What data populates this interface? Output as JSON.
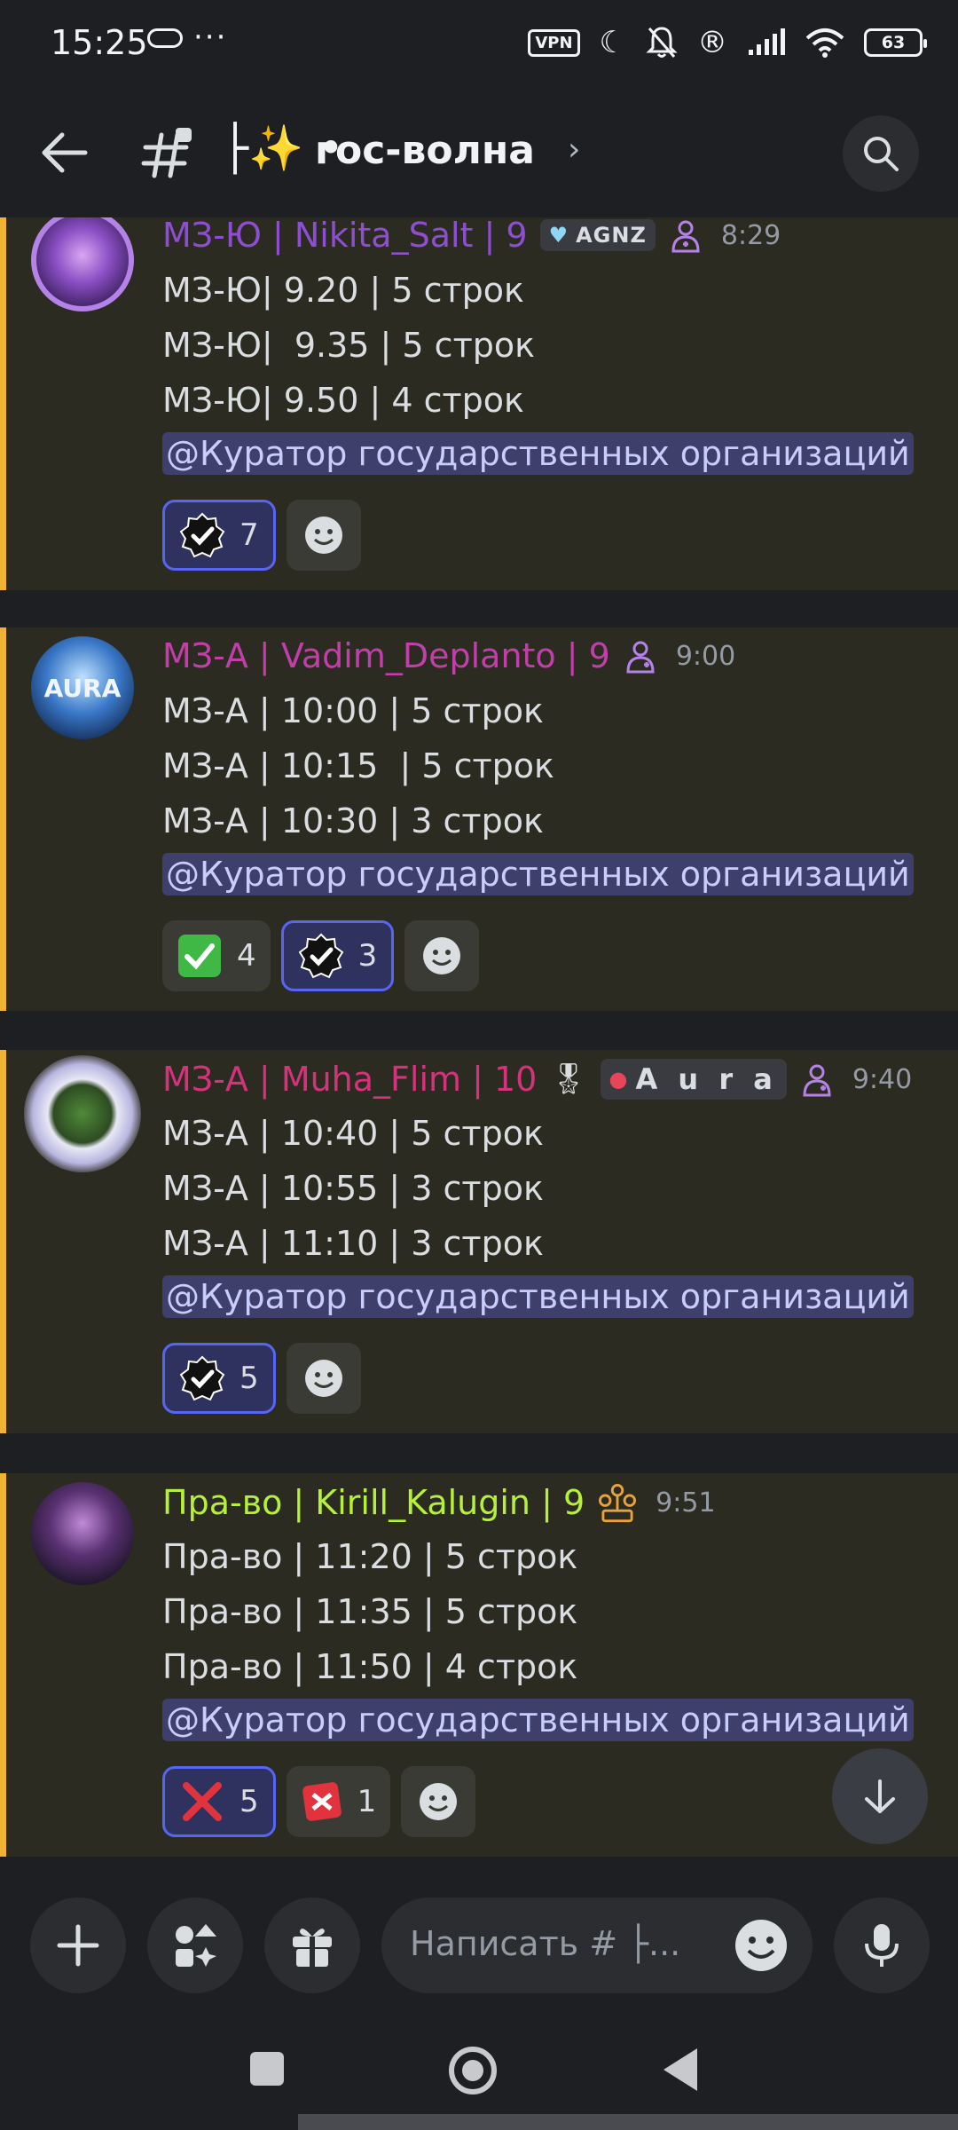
{
  "status_bar": {
    "time": "15:25",
    "dots": "···",
    "vpn": "VPN",
    "battery": "63"
  },
  "header": {
    "channel_prefix": "├✨ •",
    "channel_name": "гос-волна"
  },
  "messages": [
    {
      "username": "МЗ-Ю | Nikita_Salt | 9",
      "username_color": "#8e4ed1",
      "guild_tag": "AGNZ",
      "time": "8:29",
      "lines": [
        "МЗ-Ю| 9.20 | 5 строк",
        "МЗ-Ю|  9.35 | 5 строк",
        "МЗ-Ю| 9.50 | 4 строк"
      ],
      "mention": "@Куратор государственных организаций",
      "reactions": [
        {
          "emoji": "verified-badge",
          "count": "7",
          "me": true
        }
      ]
    },
    {
      "username": "МЗ-А | Vadim_Deplanto | 9",
      "username_color": "#c23ea8",
      "avatar_text": "AURA",
      "time": "9:00",
      "lines": [
        "МЗ-А | 10:00 | 5 строк",
        "МЗ-А | 10:15  | 5 строк",
        "МЗ-А | 10:30 | 3 строк"
      ],
      "mention": "@Куратор государственных организаций",
      "reactions": [
        {
          "emoji": "green-check",
          "count": "4",
          "me": false
        },
        {
          "emoji": "verified-badge",
          "count": "3",
          "me": true
        }
      ]
    },
    {
      "username": "МЗ-А | Muha_Flim | 10",
      "username_color": "#d4337b",
      "guild_tag": "A u r a",
      "time": "9:40",
      "lines": [
        "МЗ-А | 10:40 | 5 строк",
        "МЗ-А | 10:55 | 3 строк",
        "МЗ-А | 11:10 | 3 строк"
      ],
      "mention": "@Куратор государственных организаций",
      "reactions": [
        {
          "emoji": "verified-badge",
          "count": "5",
          "me": true
        }
      ]
    },
    {
      "username": "Пра-во | Kirill_Kalugin | 9",
      "username_color": "#b5f03a",
      "time": "9:51",
      "lines": [
        "Пра-во | 11:20 | 5 строк",
        "Пра-во | 11:35 | 5 строк",
        "Пра-во | 11:50 | 4 строк"
      ],
      "mention": "@Куратор государственных организаций",
      "reactions": [
        {
          "emoji": "red-cross",
          "count": "5",
          "me": true
        },
        {
          "emoji": "red-app-badge",
          "count": "1",
          "me": false
        }
      ]
    }
  ],
  "composer": {
    "placeholder": "Написать # ├..."
  }
}
